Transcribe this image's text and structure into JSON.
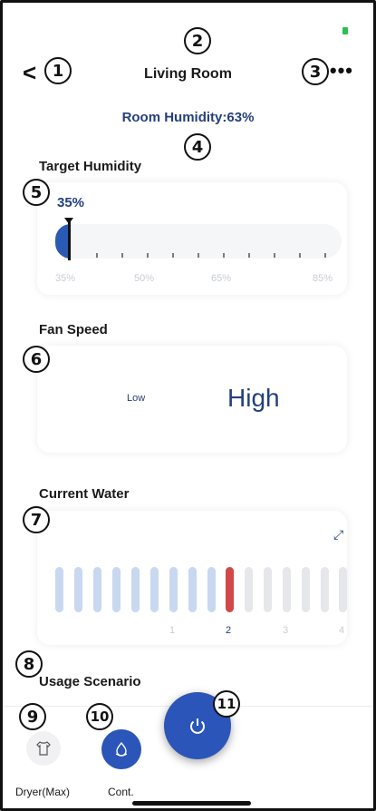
{
  "header": {
    "title": "Living Room",
    "back_icon": "chevron-left-icon",
    "more_icon": "more-dots-icon",
    "back_glyph": "<",
    "more_glyph": "•••"
  },
  "room_humidity": "Room Humidity:63%",
  "target_humidity": {
    "label": "Target Humidity",
    "value": "35%",
    "slider_value_percent": 35,
    "tick_labels": [
      "35%",
      "50%",
      "65%",
      "85%"
    ]
  },
  "fan_speed": {
    "label": "Fan Speed",
    "options": [
      "Low",
      "High"
    ],
    "selected": "High"
  },
  "current_water": {
    "label": "Current Water",
    "level_labels": [
      "1",
      "2",
      "3",
      "4"
    ],
    "selected_level": "2",
    "expand_icon": "expand-arrows-icon",
    "expand_glyph": "⤢"
  },
  "usage_scenario": {
    "label": "Usage Scenario",
    "items": [
      {
        "label": "Dryer(Max)",
        "icon": "shirt-icon",
        "active": false
      },
      {
        "label": "Cont.",
        "icon": "water-drop-icon",
        "active": true
      }
    ]
  },
  "power_button": {
    "icon": "power-icon"
  },
  "annotations": [
    "1",
    "2",
    "3",
    "4",
    "5",
    "6",
    "7",
    "8",
    "9",
    "10",
    "11"
  ],
  "colors": {
    "accent": "#2b55b8",
    "text_blue": "#24407e",
    "water_current": "#d24848",
    "water_filled": "#c8d8f0",
    "status_green": "#27c24c"
  }
}
